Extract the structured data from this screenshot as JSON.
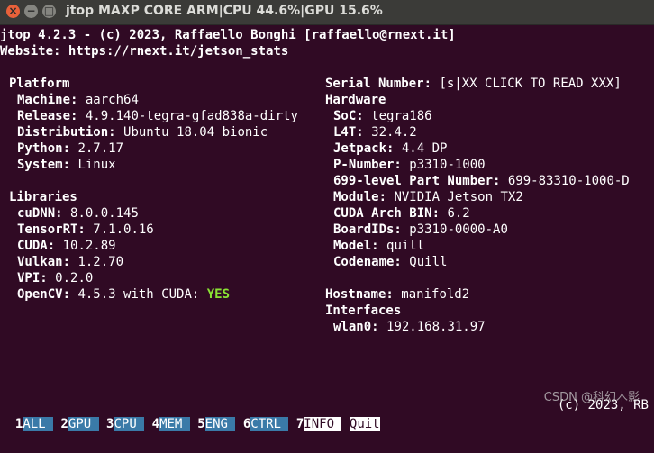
{
  "window": {
    "title": "jtop MAXP CORE ARM|CPU 44.6%|GPU 15.6%",
    "close_glyph": "×",
    "min_glyph": "−",
    "max_glyph": "□"
  },
  "header": {
    "version_line": "jtop 4.2.3 - (c) 2023, Raffaello Bonghi [raffaello@rnext.it]",
    "website_line": "Website: https://rnext.it/jetson_stats"
  },
  "platform": {
    "heading": "Platform",
    "items": [
      {
        "label": "Machine:",
        "value": "aarch64"
      },
      {
        "label": "Release:",
        "value": "4.9.140-tegra-gfad838a-dirty"
      },
      {
        "label": "Distribution:",
        "value": "Ubuntu 18.04 bionic"
      },
      {
        "label": "Python:",
        "value": "2.7.17"
      },
      {
        "label": "System:",
        "value": "Linux"
      }
    ]
  },
  "libraries": {
    "heading": "Libraries",
    "items": [
      {
        "label": "cuDNN:",
        "value": "8.0.0.145"
      },
      {
        "label": "TensorRT:",
        "value": "7.1.0.16"
      },
      {
        "label": "CUDA:",
        "value": "10.2.89"
      },
      {
        "label": "Vulkan:",
        "value": "1.2.70"
      },
      {
        "label": "VPI:",
        "value": "0.2.0"
      },
      {
        "label": "OpenCV:",
        "value": "4.5.3 with CUDA:",
        "flag": "YES"
      }
    ]
  },
  "serial": {
    "label": "Serial Number:",
    "value": "[s|XX CLICK TO READ XXX]"
  },
  "hardware": {
    "heading": "Hardware",
    "items": [
      {
        "label": "SoC:",
        "value": "tegra186"
      },
      {
        "label": "L4T:",
        "value": "32.4.2"
      },
      {
        "label": "Jetpack:",
        "value": "4.4 DP"
      },
      {
        "label": "P-Number:",
        "value": "p3310-1000"
      },
      {
        "label": "699-level Part Number:",
        "value": "699-83310-1000-D"
      },
      {
        "label": "Module:",
        "value": "NVIDIA Jetson TX2"
      },
      {
        "label": "CUDA Arch BIN:",
        "value": "6.2"
      },
      {
        "label": "BoardIDs:",
        "value": "p3310-0000-A0"
      },
      {
        "label": "Model:",
        "value": "quill"
      },
      {
        "label": "Codename:",
        "value": "Quill"
      }
    ]
  },
  "hostname": {
    "label": "Hostname:",
    "value": "manifold2"
  },
  "interfaces": {
    "heading": "Interfaces",
    "items": [
      {
        "label": "wlan0:",
        "value": "192.168.31.97"
      }
    ]
  },
  "tabs": [
    {
      "key": "1",
      "label": "ALL"
    },
    {
      "key": "2",
      "label": "GPU"
    },
    {
      "key": "3",
      "label": "CPU"
    },
    {
      "key": "4",
      "label": "MEM"
    },
    {
      "key": "5",
      "label": "ENG"
    },
    {
      "key": "6",
      "label": "CTRL"
    },
    {
      "key": "7",
      "label": "INFO"
    },
    {
      "key": "Q",
      "label": "uit"
    }
  ],
  "footer": {
    "copyright": "(c) 2023, RB"
  },
  "watermark": "CSDN @科幻木影"
}
